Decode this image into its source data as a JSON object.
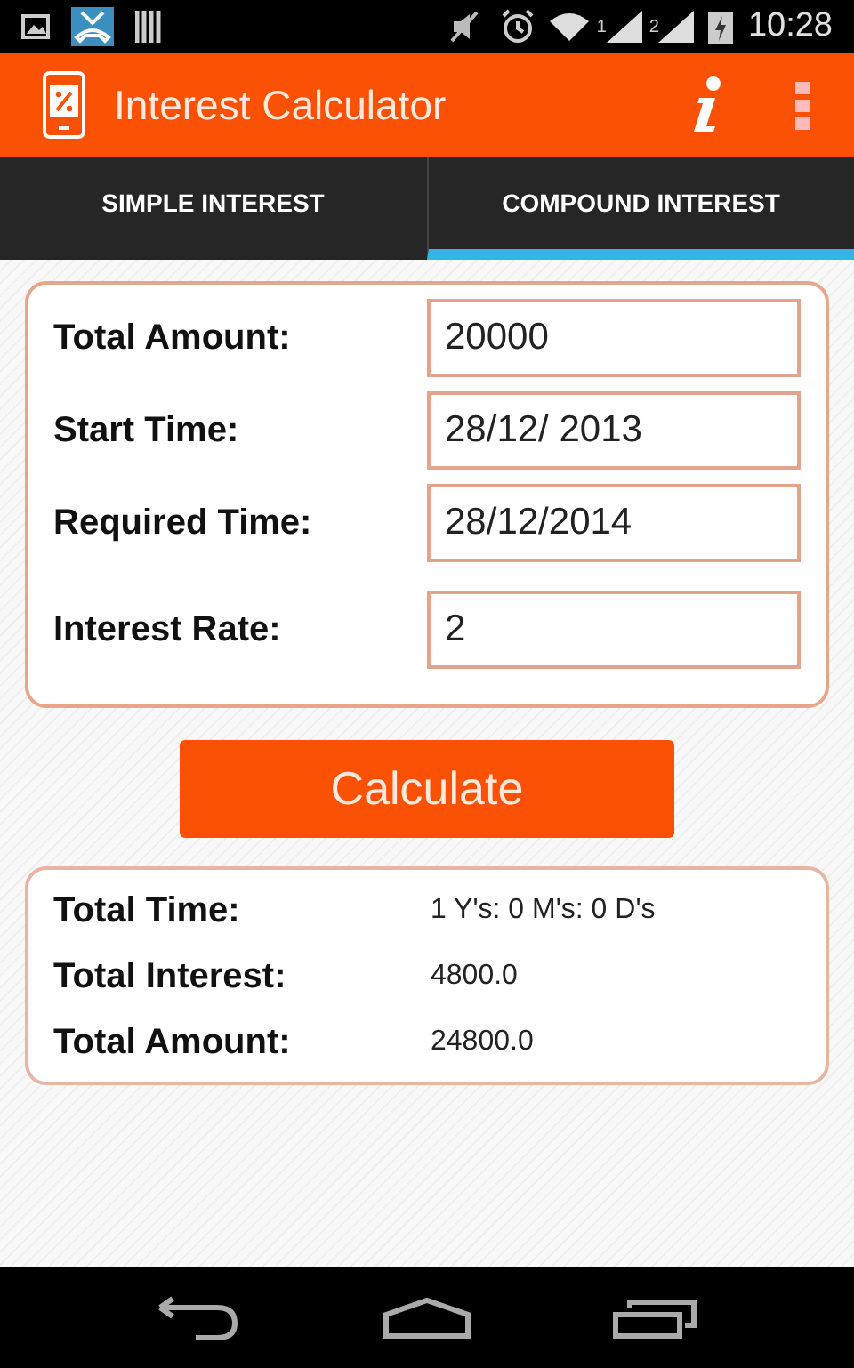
{
  "status_bar": {
    "sim_1": "1",
    "sim_2": "2",
    "time": "10:28"
  },
  "app_bar": {
    "title": "Interest Calculator"
  },
  "tabs": [
    {
      "label": "SIMPLE INTEREST",
      "selected": false
    },
    {
      "label": "COMPOUND INTEREST",
      "selected": true
    }
  ],
  "inputs": [
    {
      "label": "Total Amount:",
      "value": "20000"
    },
    {
      "label": "Start Time:",
      "value": "28/12/ 2013"
    },
    {
      "label": "Required Time:",
      "value": "28/12/2014"
    },
    {
      "label": "Interest Rate:",
      "value": "2"
    }
  ],
  "button": "Calculate",
  "results": [
    {
      "label": "Total Time:",
      "value": "1 Y's: 0 M's: 0 D's"
    },
    {
      "label": "Total Interest:",
      "value": "4800.0"
    },
    {
      "label": "Total Amount:",
      "value": "24800.0"
    }
  ]
}
